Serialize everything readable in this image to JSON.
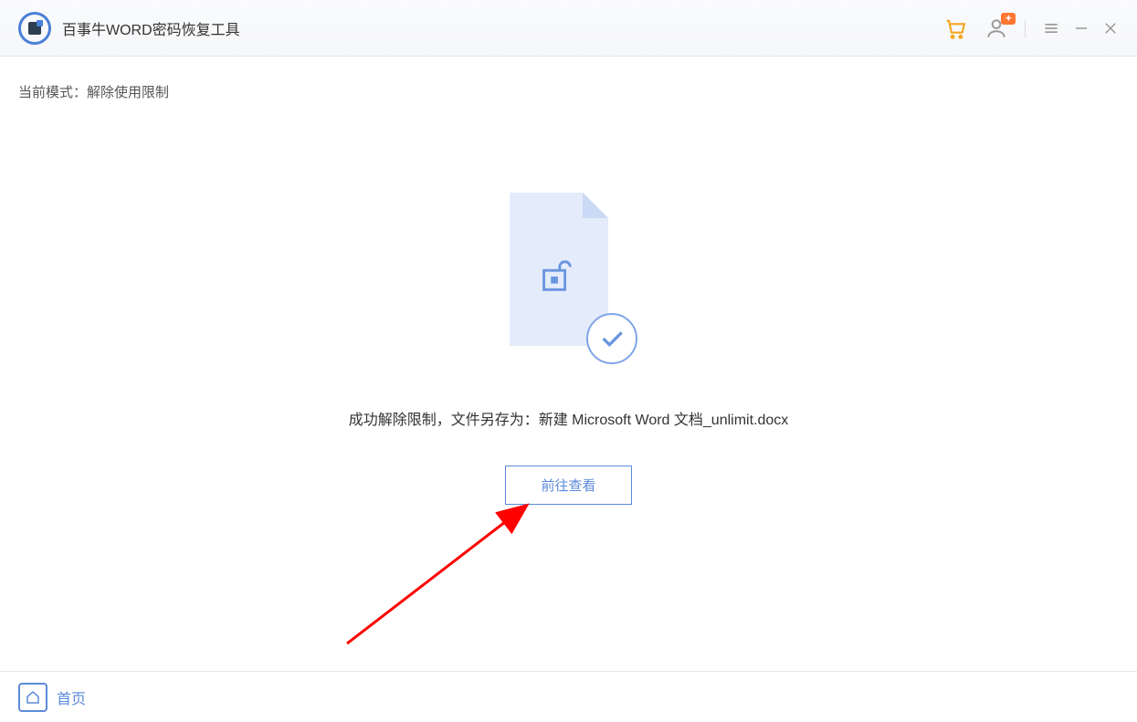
{
  "header": {
    "title": "百事牛WORD密码恢复工具"
  },
  "mode": {
    "label": "当前模式：",
    "value": "解除使用限制"
  },
  "result": {
    "message_prefix": "成功解除限制，文件另存为：",
    "filename": "新建 Microsoft Word 文档_unlimit.docx",
    "view_button": "前往查看"
  },
  "footer": {
    "home": "首页"
  }
}
